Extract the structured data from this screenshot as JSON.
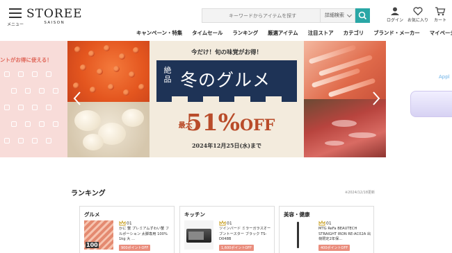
{
  "header": {
    "menu_label": "メニュー",
    "logo_main": "STOREE",
    "logo_sub": "SAISON",
    "search_placeholder": "キーワードからアイテムを探す",
    "detail_search": "詳細検索",
    "login": "ログイン",
    "favorites": "お気に入り",
    "cart": "カート"
  },
  "nav": [
    "キャンペーン・特集",
    "タイムセール",
    "ランキング",
    "厳選アイテム",
    "注目ストア",
    "カテゴリ",
    "ブランド・メーカー",
    "マイページ"
  ],
  "banner": {
    "left_peek_text": "ントがお得に使える！",
    "right_peek_text": "Appl",
    "tagline": "今だけ！旬の味覚がお得！",
    "badge": "絶品",
    "title": "冬のグルメ",
    "prefix": "最大",
    "percent": "51%",
    "off": "OFF",
    "until": "2024年12月25日(水)まで"
  },
  "ranking": {
    "title": "ランキング",
    "updated": "※2024/12/18更新",
    "cards": [
      {
        "category": "グルメ",
        "rank": "01",
        "name": "かに 蟹 プレミアムずわい蟹 フルポーション 太脚専用 100% 1kg 大 ...",
        "points": "900ポイントOFF",
        "thumb_label": "100"
      },
      {
        "category": "キッチン",
        "rank": "01",
        "name": "ツインバード ミラーガラスオーブントースター ブラック TS-D048B",
        "points": "1,600ポイントOFF"
      },
      {
        "category": "美容・健康",
        "rank": "01",
        "name": "MTG ReFa BEAUTECH STRAIGHT IRON RE-AC02A 出荷限定2年保...",
        "points": "400ポイントOFF"
      }
    ]
  },
  "colors": {
    "accent": "#2aa7a6",
    "navy": "#1e3356",
    "deal_red": "#b94c2a",
    "points_badge": "#ea8e7e"
  }
}
